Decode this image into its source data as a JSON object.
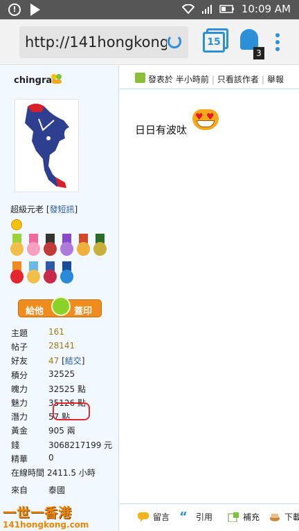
{
  "status_bar": {
    "time": "10:09 AM",
    "alert_glyph": "!"
  },
  "browser": {
    "url": "http://141hongkong.com",
    "tab_count": "15",
    "ghost_badge": "3"
  },
  "user": {
    "name": "chingrai",
    "rank": "超級元老",
    "send_pm": "發短訊",
    "give_left": "給他",
    "give_right": "蓋印",
    "stats": [
      {
        "key": "主題",
        "value": "161"
      },
      {
        "key": "帖子",
        "value": "28141"
      },
      {
        "key": "好友",
        "value": "47",
        "extra": "結交"
      },
      {
        "key": "積分",
        "value": "32525"
      },
      {
        "key": "魄力",
        "value": "32525 點"
      },
      {
        "key": "魅力",
        "value": "35126 點"
      },
      {
        "key": "潛力",
        "value": "57 點"
      },
      {
        "key": "黃金",
        "value": "905 兩"
      },
      {
        "key": "錢",
        "value": "3068217199 元"
      },
      {
        "key": "精華",
        "value": "0"
      },
      {
        "key": "在線時間",
        "value": "2411.5 小時"
      }
    ],
    "from_key": "來自",
    "from_value": "泰國"
  },
  "post": {
    "posted": "發表於 半小時前",
    "only_author": "只看該作者",
    "report": "舉報",
    "body": "日日有波呔"
  },
  "actions": {
    "comment": "留言",
    "quote": "引用",
    "supplement": "補充",
    "more": "下載"
  },
  "watermark": {
    "top": "一世一香港",
    "bottom": "141hongkong.com"
  },
  "colors": {
    "accent": "#2c8fd8",
    "sidebar_bg": "#f2f8ff",
    "link": "#2458a6",
    "highlight": "#e2262b"
  }
}
